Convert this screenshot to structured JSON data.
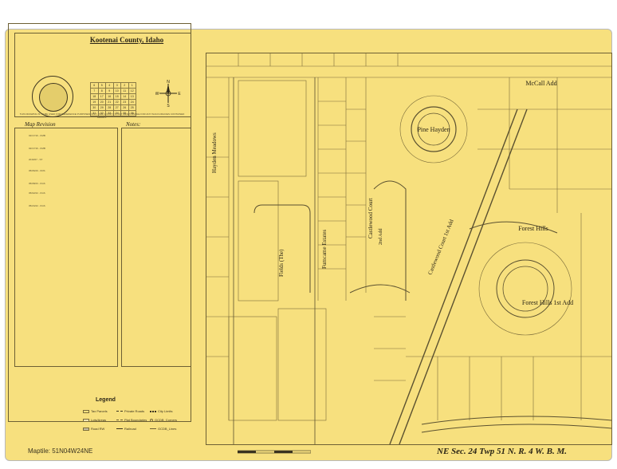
{
  "title_block": {
    "county": "Kootenai County, Idaho",
    "disclaimer": "THIS DRAWING IS TO BE USED FOR REFERENCE PURPOSES ONLY. THE COUNTY IS NOT RESPONSIBLE FOR ANY INACCURACIES CONTAINED HEREIN.",
    "compass": {
      "n": "N",
      "e": "E",
      "s": "S",
      "w": "W"
    }
  },
  "map_revision": {
    "heading": "Map Revision",
    "entries": [
      "02/17/16 - KMB",
      "02/17/16 - KMB",
      "2016/07 - ST",
      "05/06/20 - KDS",
      "05/08/23 - KGS",
      "05/02/22 - KGS",
      "05/24/22 - KGS"
    ]
  },
  "notes": {
    "heading": "Notes:"
  },
  "legend": {
    "heading": "Legend",
    "items": [
      {
        "label": "Tax Parcels",
        "symbol": "box"
      },
      {
        "label": "Private Roads",
        "symbol": "dash"
      },
      {
        "label": "City Limits",
        "symbol": "dots"
      },
      {
        "label": "Lots/Areas",
        "symbol": "box"
      },
      {
        "label": "Plat Boundaries",
        "symbol": "dash"
      },
      {
        "label": "GCDB_Corners",
        "symbol": "circle"
      },
      {
        "label": "Road RW",
        "symbol": "box"
      },
      {
        "label": "Railroad",
        "symbol": "rail"
      },
      {
        "label": "GCDB_Lines",
        "symbol": "line"
      }
    ]
  },
  "maptile": "Maptile: 51N04W24NE",
  "sheet_title": "NE Sec. 24 Twp 51 N.  R. 4  W. B. M.",
  "map_labels": {
    "subdivisions": [
      "Pine Hayden",
      "McCall Add",
      "Forest Hills",
      "Forest Hills 1st Add",
      "Castlewood Court",
      "Castlewood Court 1st Add",
      "2nd Add",
      "Fumcame Estates",
      "Fields (The)",
      "Hayden Meadows"
    ]
  },
  "colors": {
    "paper": "#f7e07e",
    "ink": "#3a3320",
    "border": "#6d6034"
  }
}
